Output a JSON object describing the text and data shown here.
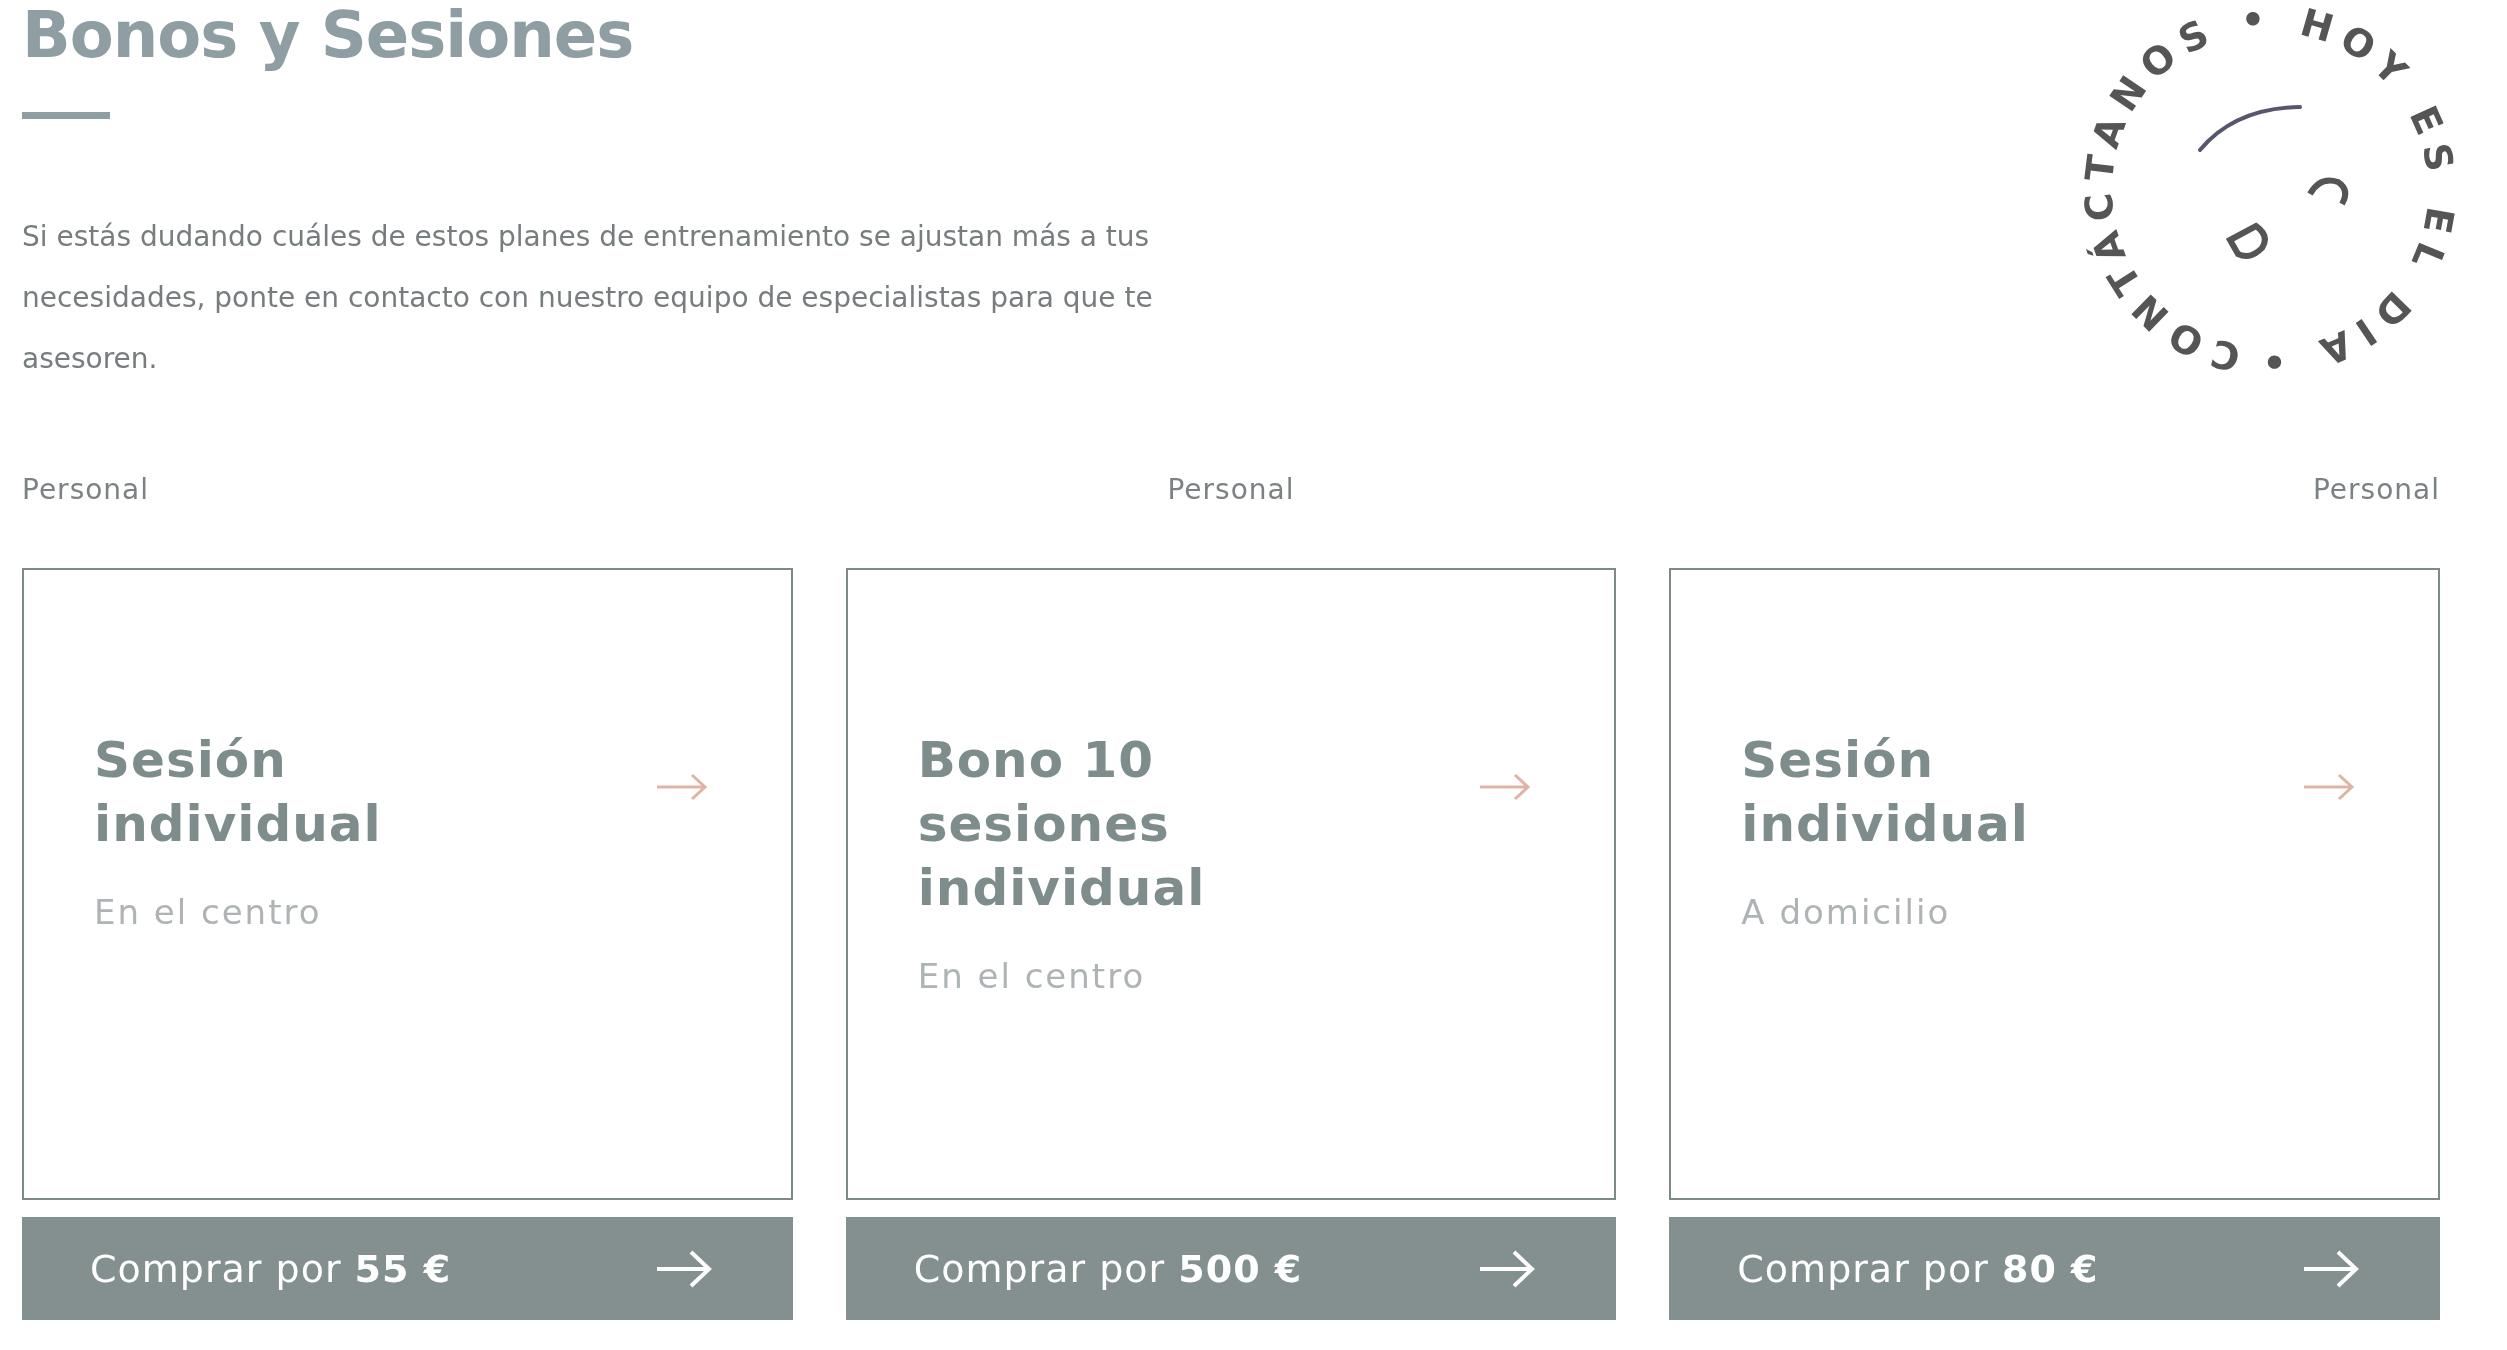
{
  "header": {
    "title": "Bonos y Sesiones",
    "description": "Si estás dudando cuáles de estos planes de entrenamiento se ajustan más a tus necesidades, ponte en contacto con nuestro equipo de especialistas para que te asesoren."
  },
  "badge": {
    "text": "CONTÁCTANOS • HOY ES EL DIA •"
  },
  "plans": [
    {
      "category": "Personal",
      "title": "Sesión individual",
      "subtitle": "En el centro",
      "button": "Comprar por **55 €**"
    },
    {
      "category": "Personal",
      "title": "Bono 10 sesiones individual",
      "subtitle": "En el centro",
      "button": "Comprar por **500 €**"
    },
    {
      "category": "Personal",
      "title": "Sesión individual",
      "subtitle": "A domicilio",
      "button": "Comprar por **80 €**"
    }
  ]
}
